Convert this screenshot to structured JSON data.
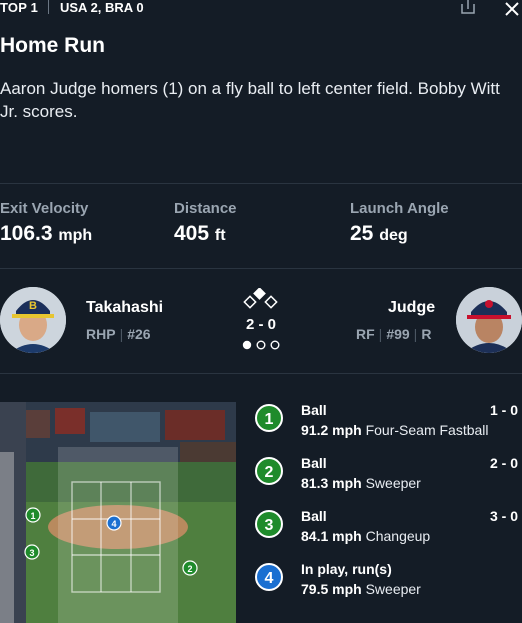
{
  "header": {
    "inning": "TOP 1",
    "score": "USA 2, BRA 0"
  },
  "play": {
    "title": "Home Run",
    "description": "Aaron Judge homers (1) on a fly ball to left center field. Bobby Witt Jr. scores."
  },
  "stats": [
    {
      "label": "Exit Velocity",
      "value": "106.3",
      "unit": "mph"
    },
    {
      "label": "Distance",
      "value": "405",
      "unit": "ft"
    },
    {
      "label": "Launch Angle",
      "value": "25",
      "unit": "deg"
    }
  ],
  "pitcher": {
    "name": "Takahashi",
    "hand": "RHP",
    "number": "#26"
  },
  "batter": {
    "name": "Judge",
    "position": "RF",
    "number": "#99",
    "bats": "R"
  },
  "situation": {
    "count": "2 - 0",
    "outs": 1
  },
  "pitches": [
    {
      "num": "1",
      "result": "Ball",
      "count": "1 - 0",
      "speed": "91.2 mph",
      "type": "Four-Seam Fastball",
      "color": "#1f8b2b"
    },
    {
      "num": "2",
      "result": "Ball",
      "count": "2 - 0",
      "speed": "81.3 mph",
      "type": "Sweeper",
      "color": "#1f8b2b"
    },
    {
      "num": "3",
      "result": "Ball",
      "count": "3 - 0",
      "speed": "84.1 mph",
      "type": "Changeup",
      "color": "#1f8b2b"
    },
    {
      "num": "4",
      "result": "In play, run(s)",
      "count": "",
      "speed": "79.5 mph",
      "type": "Sweeper",
      "color": "#1a6fd1"
    }
  ],
  "icons": {
    "share": "share-icon",
    "close": "close-icon",
    "bases": "bases-icon"
  }
}
